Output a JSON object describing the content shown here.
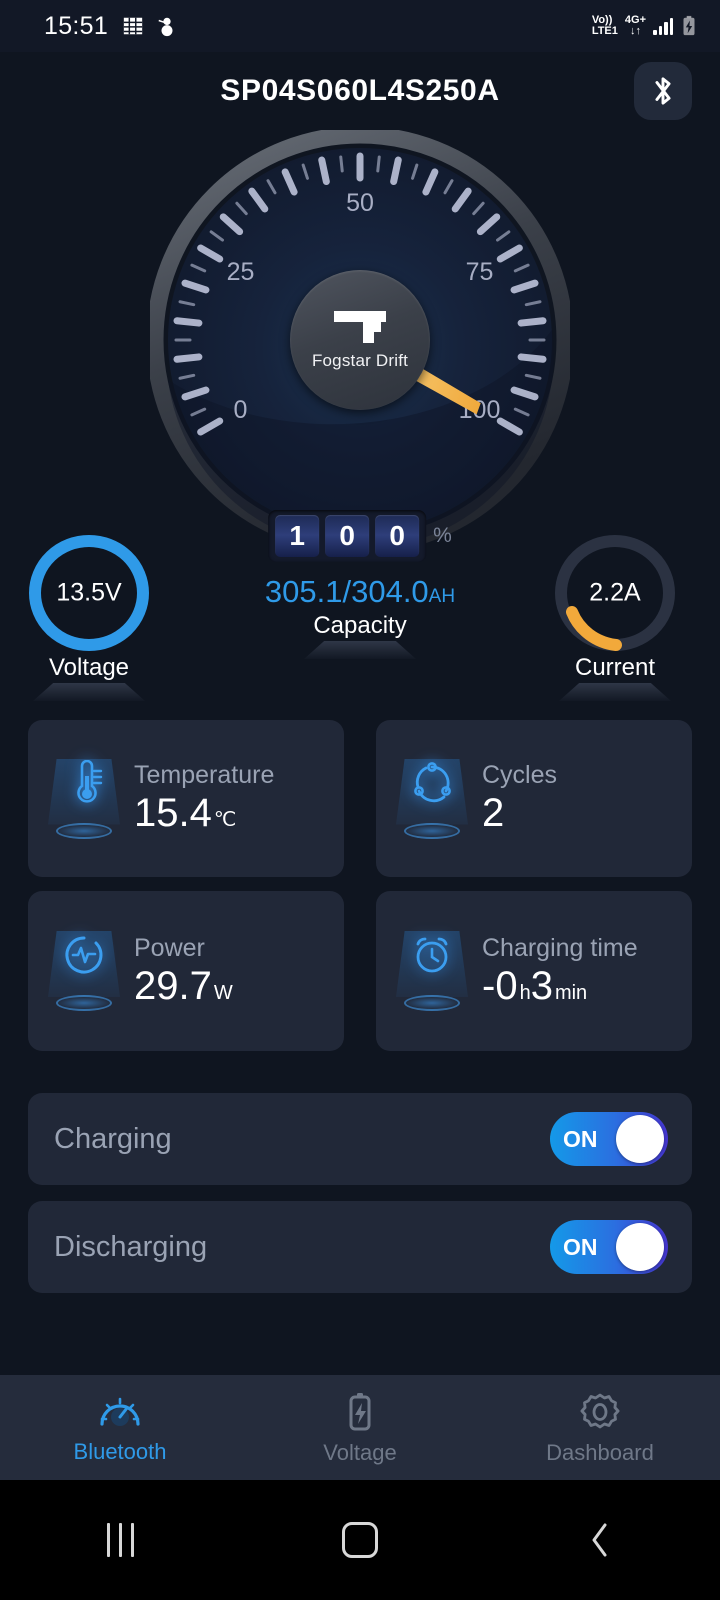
{
  "status_bar": {
    "time": "15:51",
    "left_icons": [
      "calendar-icon",
      "snowman-icon"
    ],
    "volte": "Vo))",
    "volte_sub": "LTE1",
    "network": "4G+",
    "network_arrows": "↓↑",
    "signal_icon": "signal-bars-icon",
    "battery_icon": "battery-charging-icon"
  },
  "header": {
    "title": "SP04S060L4S250A",
    "bluetooth_icon": "bluetooth-icon"
  },
  "gauge": {
    "brand": "Fogstar Drift",
    "ticks": [
      "0",
      "25",
      "50",
      "75",
      "100"
    ],
    "value_digits": [
      "1",
      "0",
      "0"
    ],
    "unit": "%",
    "needle_value": 100,
    "needle_color": "#f5c359"
  },
  "stats": {
    "voltage": {
      "value": "13.5V",
      "label": "Voltage",
      "ring_color": "#2f9ae8",
      "fill": 100
    },
    "capacity": {
      "value": "305.1/304.0",
      "unit": "AH",
      "label": "Capacity",
      "color": "#2f9ae8"
    },
    "current": {
      "value": "2.2A",
      "label": "Current",
      "ring_color": "#f2a93b",
      "fill": 14
    }
  },
  "cards": [
    {
      "label": "Temperature",
      "value": "15.4",
      "unit": "℃",
      "icon": "thermometer-icon"
    },
    {
      "label": "Cycles",
      "value": "2",
      "unit": "",
      "icon": "cycles-icon"
    },
    {
      "label": "Power",
      "value": "29.7",
      "unit": "W",
      "icon": "power-pulse-icon"
    },
    {
      "label": "Charging time",
      "value": "-0",
      "unit": "h",
      "value2": "3",
      "unit2": "min",
      "icon": "alarm-clock-icon"
    }
  ],
  "toggles": [
    {
      "label": "Charging",
      "state": "ON"
    },
    {
      "label": "Discharging",
      "state": "ON"
    }
  ],
  "bottom_nav": [
    {
      "label": "Bluetooth",
      "icon": "gauge-icon",
      "active": true
    },
    {
      "label": "Voltage",
      "icon": "battery-bolt-icon",
      "active": false
    },
    {
      "label": "Dashboard",
      "icon": "gear-icon",
      "active": false
    }
  ],
  "system_nav": {
    "recents": "recents-icon",
    "home": "home-icon",
    "back": "back-icon"
  }
}
